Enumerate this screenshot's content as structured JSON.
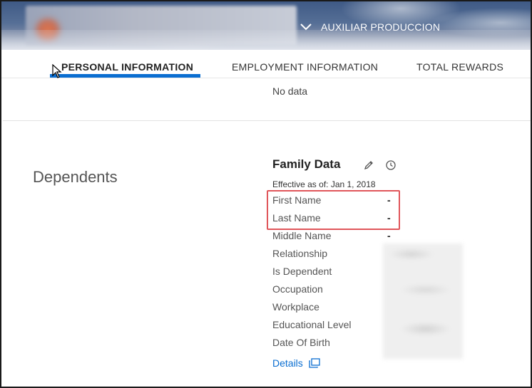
{
  "header": {
    "job_title": "AUXILIAR PRODUCCION",
    "chevron_icon": "chevron-down-icon"
  },
  "tabs": [
    {
      "label": "PERSONAL INFORMATION",
      "active": true
    },
    {
      "label": "EMPLOYMENT INFORMATION",
      "active": false
    },
    {
      "label": "TOTAL REWARDS",
      "active": false
    }
  ],
  "previous_section": {
    "value": "No data"
  },
  "dependents": {
    "section_title": "Dependents",
    "card_title": "Family Data",
    "effective_label": "Effective as of: Jan 1, 2018",
    "fields": [
      {
        "label": "First Name",
        "value": "-"
      },
      {
        "label": "Last Name",
        "value": "-"
      },
      {
        "label": "Middle Name",
        "value": "-"
      },
      {
        "label": "Relationship",
        "value": ""
      },
      {
        "label": "Is Dependent",
        "value": ""
      },
      {
        "label": "Occupation",
        "value": ""
      },
      {
        "label": "Workplace",
        "value": ""
      },
      {
        "label": "Educational Level",
        "value": ""
      },
      {
        "label": "Date Of Birth",
        "value": ""
      }
    ],
    "details_link": "Details"
  },
  "colors": {
    "accent": "#0a6ed1",
    "highlight_border": "#e0555a"
  }
}
